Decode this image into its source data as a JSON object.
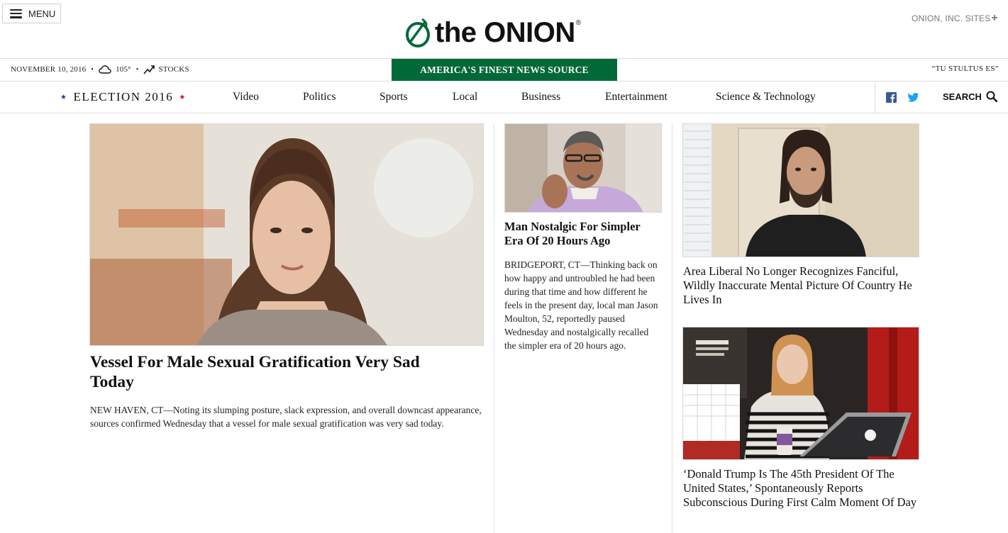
{
  "header": {
    "menu_label": "MENU",
    "logo_text": "the ONION",
    "logo_mark": "®",
    "sites_label": "ONION, INC. SITES",
    "sites_plus": "+"
  },
  "strip": {
    "date": "NOVEMBER 10, 2016",
    "temperature": "105°",
    "stocks_label": "STOCKS",
    "tagline": "AMERICA'S FINEST NEWS SOURCE",
    "motto": "“TU STULTUS ES”"
  },
  "nav": {
    "election_label": "ELECTION 2016",
    "items": [
      "Video",
      "Politics",
      "Sports",
      "Local",
      "Business",
      "Entertainment",
      "Science & Technology"
    ],
    "search_label": "SEARCH"
  },
  "colors": {
    "brand_green": "#006937",
    "twitter_blue": "#1da1f2",
    "facebook_blue": "#3b5998",
    "star_blue": "#1c3f94",
    "star_red": "#c21b2f"
  },
  "articles": {
    "main": {
      "headline": "Vessel For Male Sexual Gratification Very Sad Today",
      "excerpt": "NEW HAVEN, CT—Noting its slumping posture, slack expression, and overall downcast appearance, sources confirmed Wednesday that a vessel for male sexual gratification was very sad today."
    },
    "middle": {
      "headline": "Man Nostalgic For Simpler Era Of 20 Hours Ago",
      "excerpt": "BRIDGEPORT, CT—Thinking back on how happy and untroubled he had been during that time and how different he feels in the present day, local man Jason Moulton, 52, reportedly paused Wednesday and nostalgically recalled the simpler era of 20 hours ago."
    },
    "side_top": {
      "headline": "Area Liberal No Longer Recognizes Fanciful, Wildly Inaccurate Mental Picture Of Country He Lives In"
    },
    "side_bottom": {
      "headline": "‘Donald Trump Is The 45th President Of The United States,’ Spontaneously Reports Subconscious During First Calm Moment Of Day"
    }
  }
}
